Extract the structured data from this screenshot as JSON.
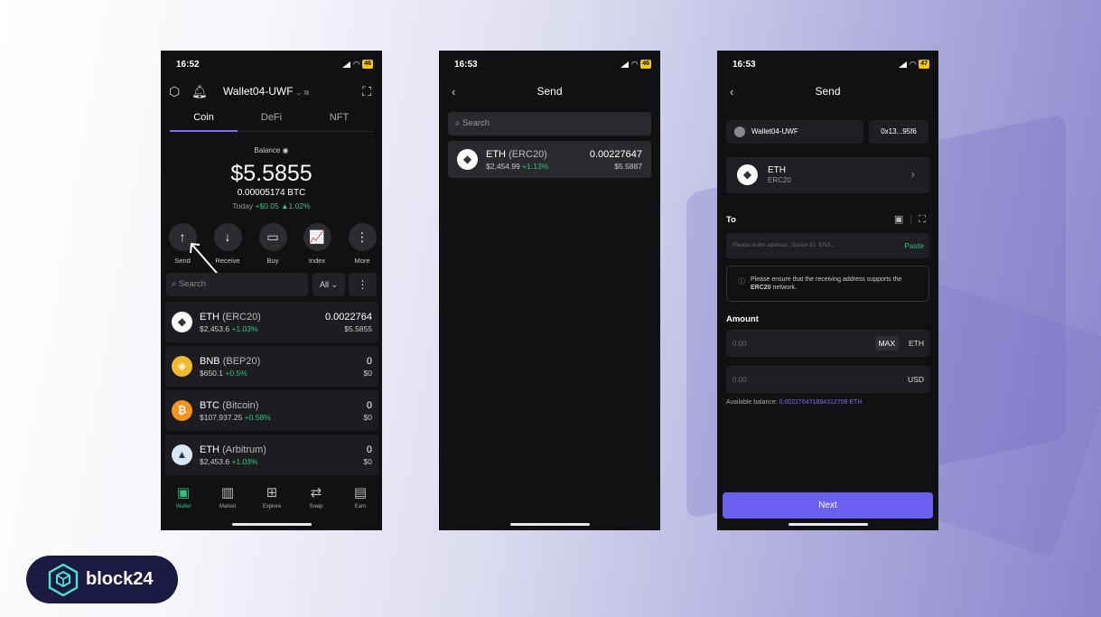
{
  "brand": {
    "name": "block24"
  },
  "phone1": {
    "status": {
      "time": "16:52",
      "battery": "46"
    },
    "wallet_name": "Wallet04-UWF",
    "tabs": [
      "Coin",
      "DeFi",
      "NFT"
    ],
    "balance_label": "Balance",
    "balance_amount": "$5.5855",
    "balance_btc": "0.00005174 BTC",
    "today_label": "Today",
    "today_change": "+$0.05 ▲1.02%",
    "actions": [
      {
        "label": "Send",
        "glyph": "↑"
      },
      {
        "label": "Receive",
        "glyph": "↓"
      },
      {
        "label": "Buy",
        "glyph": "▭"
      },
      {
        "label": "Index",
        "glyph": "📈"
      },
      {
        "label": "More",
        "glyph": "⋮"
      }
    ],
    "search_placeholder": "Search",
    "filter": "All",
    "coins": [
      {
        "symbol": "ETH",
        "network": "(ERC20)",
        "price": "$2,453.6",
        "change": "+1.03%",
        "amount": "0.0022764",
        "usd": "$5.5855",
        "color": "#ffffff",
        "glyph": "◆"
      },
      {
        "symbol": "BNB",
        "network": "(BEP20)",
        "price": "$650.1",
        "change": "+0.5%",
        "amount": "0",
        "usd": "$0",
        "color": "#f3ba2f",
        "glyph": "◈"
      },
      {
        "symbol": "BTC",
        "network": "(Bitcoin)",
        "price": "$107,937.25",
        "change": "+0.58%",
        "amount": "0",
        "usd": "$0",
        "color": "#f7931a",
        "glyph": "₿"
      },
      {
        "symbol": "ETH",
        "network": "(Arbitrum)",
        "price": "$2,453.6",
        "change": "+1.03%",
        "amount": "0",
        "usd": "$0",
        "color": "#d9e6f5",
        "glyph": "▲"
      }
    ],
    "nav": [
      "Wallet",
      "Market",
      "Explore",
      "Swap",
      "Earn"
    ]
  },
  "phone2": {
    "status": {
      "time": "16:53",
      "battery": "46"
    },
    "title": "Send",
    "search_placeholder": "Search",
    "coin": {
      "symbol": "ETH",
      "network": "(ERC20)",
      "price": "$2,454.99",
      "change": "+1.13%",
      "amount": "0.00227647",
      "usd": "$5.5887"
    }
  },
  "phone3": {
    "status": {
      "time": "16:53",
      "battery": "47"
    },
    "title": "Send",
    "wallet_name": "Wallet04-UWF",
    "address_short": "0x13...95f6",
    "token": {
      "symbol": "ETH",
      "network": "ERC20"
    },
    "to_label": "To",
    "address_placeholder": "Please enter address, Space ID, ENS...",
    "paste_label": "Paste",
    "notice_pre": "Please ensure that the receiving address supports the ",
    "notice_bold": "ERC20",
    "notice_post": " network.",
    "amount_label": "Amount",
    "amount_placeholder": "0.00",
    "max_label": "MAX",
    "unit_eth": "ETH",
    "usd_placeholder": "0.00",
    "unit_usd": "USD",
    "available_label": "Available balance: ",
    "available_value": "0.002276471894312708 ETH",
    "next_label": "Next"
  }
}
